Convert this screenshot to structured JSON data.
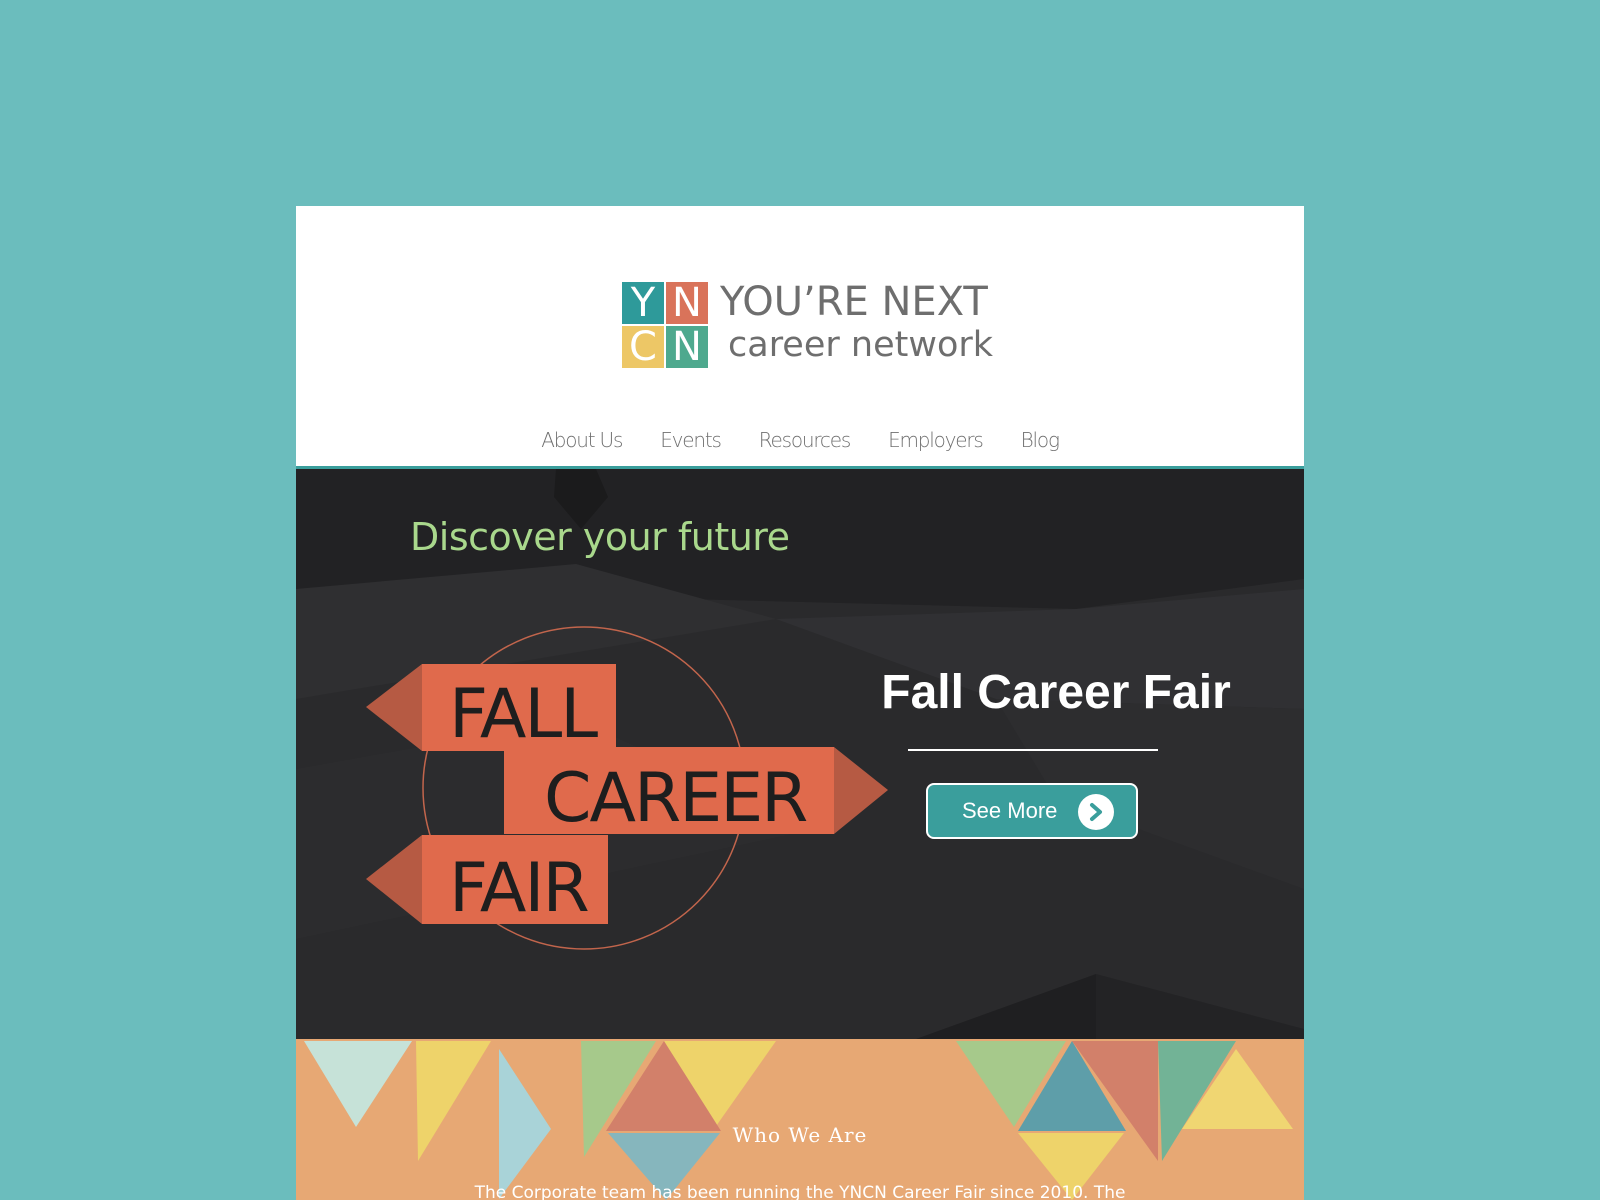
{
  "page": {
    "background": "#6bbdbd",
    "accent": "#3a9e9c"
  },
  "logo": {
    "letters": [
      "Y",
      "N",
      "C",
      "N"
    ],
    "colors": [
      "#2e9a9a",
      "#d9735a",
      "#edc766",
      "#4ea98e"
    ],
    "line1": "YOU’RE NEXT",
    "line2": "career network"
  },
  "nav": {
    "items": [
      {
        "label": "About Us"
      },
      {
        "label": "Events"
      },
      {
        "label": "Resources"
      },
      {
        "label": "Employers"
      },
      {
        "label": "Blog"
      }
    ]
  },
  "hero": {
    "tagline": "Discover your future",
    "graphic_words": [
      "FALL",
      "CAREER",
      "FAIR"
    ],
    "title": "Fall Career Fair",
    "cta_label": "See More",
    "cta_icon": "chevron-right-icon",
    "arrow_color": "#e06a4c"
  },
  "about": {
    "title": "Who We Are",
    "body": "The Corporate team has been running the YNCN Career Fair since 2010. The"
  }
}
